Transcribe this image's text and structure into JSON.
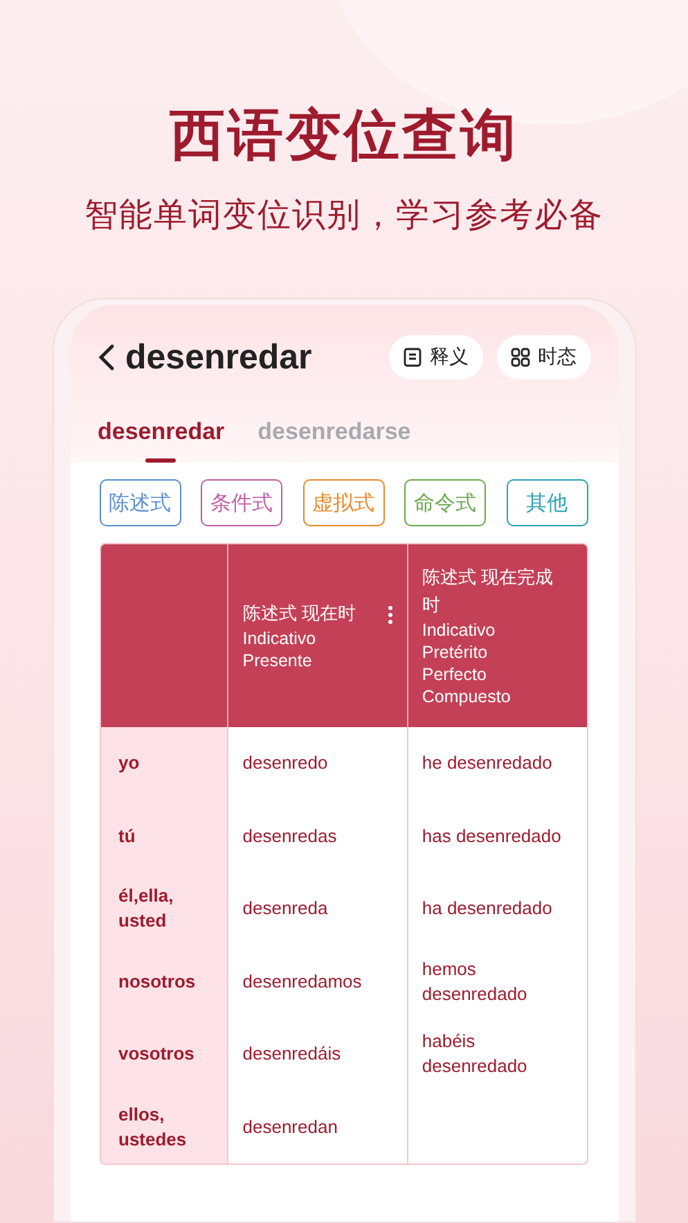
{
  "headline": "西语变位查询",
  "subheadline": "智能单词变位识别，学习参考必备",
  "screen": {
    "word": "desenredar",
    "header_buttons": [
      {
        "kind": "definition",
        "label": "释义"
      },
      {
        "kind": "tenses",
        "label": "时态"
      }
    ],
    "tabs": [
      {
        "label": "desenredar",
        "selected": true
      },
      {
        "label": "desenredarse",
        "selected": false
      }
    ],
    "moods": [
      {
        "label": "陈述式",
        "color": "#5b8fd0"
      },
      {
        "label": "条件式",
        "color": "#c060a8"
      },
      {
        "label": "虚拟式",
        "color": "#e8892c"
      },
      {
        "label": "命令式",
        "color": "#6aa84f"
      },
      {
        "label": "其他",
        "color": "#2aa3b3"
      }
    ],
    "table": {
      "columns": [
        {
          "title": "陈述式 现在时",
          "subtitle": "Indicativo Presente",
          "menu": true
        },
        {
          "title": "陈述式 现在完成时",
          "subtitle": "Indicativo Pretérito Perfecto Compuesto",
          "menu": false
        }
      ],
      "rows": [
        {
          "person": "yo",
          "cells": [
            "desenredo",
            "he desenredado"
          ]
        },
        {
          "person": "tú",
          "cells": [
            "desenredas",
            "has desenredado"
          ]
        },
        {
          "person": "él,ella, usted",
          "cells": [
            "desenreda",
            "ha desenredado"
          ]
        },
        {
          "person": "nosotros",
          "cells": [
            "desenredamos",
            "hemos desenredado"
          ]
        },
        {
          "person": "vosotros",
          "cells": [
            "desenredáis",
            "habéis desenredado"
          ]
        },
        {
          "person": "ellos, ustedes",
          "cells": [
            "desenredan"
          ]
        }
      ]
    }
  }
}
